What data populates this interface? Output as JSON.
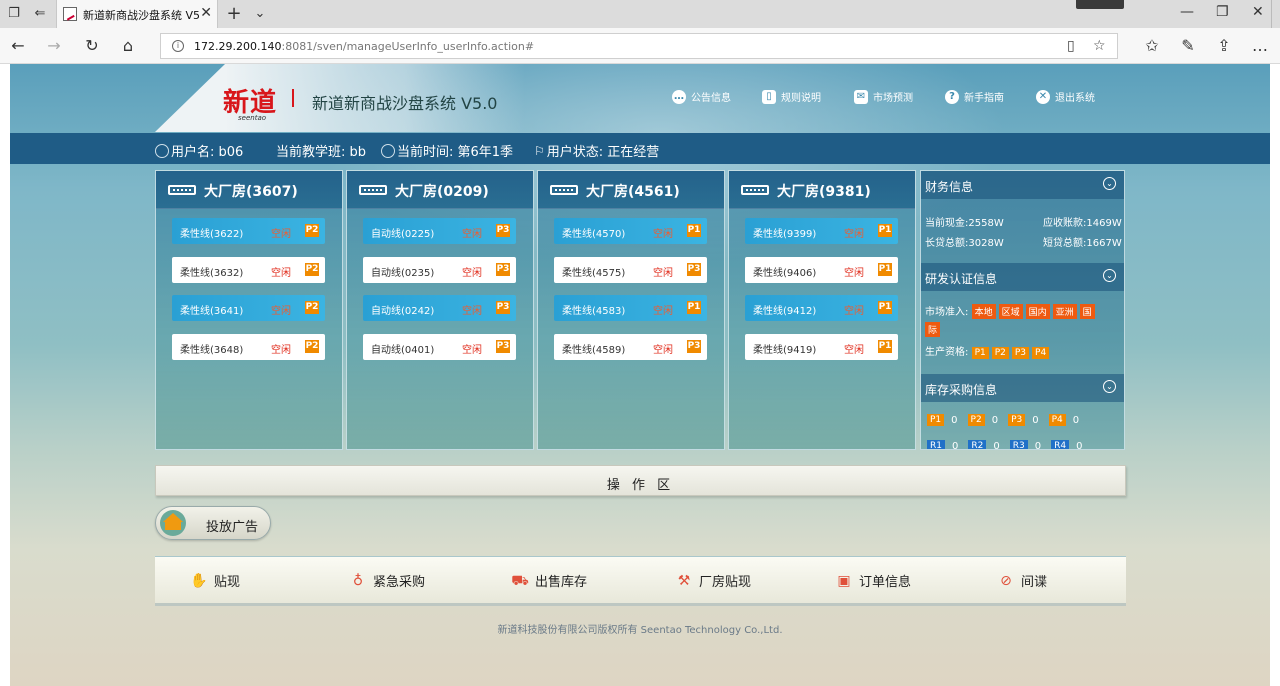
{
  "browser": {
    "tab_title": "新道新商战沙盘系统 V5",
    "url_host": "172.29.200.140",
    "url_rest": ":8081/sven/manageUserInfo_userInfo.action#"
  },
  "header": {
    "logo_text": "新道",
    "logo_sub": "seentao",
    "system_title": "新道新商战沙盘系统 V5.0",
    "nav": [
      {
        "label": "公告信息",
        "icon": "chat-icon"
      },
      {
        "label": "规则说明",
        "icon": "document-icon"
      },
      {
        "label": "市场预测",
        "icon": "mail-icon"
      },
      {
        "label": "新手指南",
        "icon": "help-icon"
      },
      {
        "label": "退出系统",
        "icon": "close-circle-icon"
      }
    ]
  },
  "userbar": {
    "username": "用户名: b06",
    "class": "当前教学班: bb",
    "time": "当前时间: 第6年1季",
    "status": "用户状态:  正在经营"
  },
  "factories": [
    {
      "name": "大厂房(3607)",
      "lines": [
        {
          "name": "柔性线(3622)",
          "status": "空闲",
          "product": "P2",
          "style": "blue"
        },
        {
          "name": "柔性线(3632)",
          "status": "空闲",
          "product": "P2",
          "style": "white"
        },
        {
          "name": "柔性线(3641)",
          "status": "空闲",
          "product": "P2",
          "style": "blue"
        },
        {
          "name": "柔性线(3648)",
          "status": "空闲",
          "product": "P2",
          "style": "white"
        }
      ]
    },
    {
      "name": "大厂房(0209)",
      "lines": [
        {
          "name": "自动线(0225)",
          "status": "空闲",
          "product": "P3",
          "style": "blue"
        },
        {
          "name": "自动线(0235)",
          "status": "空闲",
          "product": "P3",
          "style": "white"
        },
        {
          "name": "自动线(0242)",
          "status": "空闲",
          "product": "P3",
          "style": "blue"
        },
        {
          "name": "自动线(0401)",
          "status": "空闲",
          "product": "P3",
          "style": "white"
        }
      ]
    },
    {
      "name": "大厂房(4561)",
      "lines": [
        {
          "name": "柔性线(4570)",
          "status": "空闲",
          "product": "P1",
          "style": "blue"
        },
        {
          "name": "柔性线(4575)",
          "status": "空闲",
          "product": "P3",
          "style": "white"
        },
        {
          "name": "柔性线(4583)",
          "status": "空闲",
          "product": "P1",
          "style": "blue"
        },
        {
          "name": "柔性线(4589)",
          "status": "空闲",
          "product": "P3",
          "style": "white"
        }
      ]
    },
    {
      "name": "大厂房(9381)",
      "lines": [
        {
          "name": "柔性线(9399)",
          "status": "空闲",
          "product": "P1",
          "style": "blue"
        },
        {
          "name": "柔性线(9406)",
          "status": "空闲",
          "product": "P1",
          "style": "white"
        },
        {
          "name": "柔性线(9412)",
          "status": "空闲",
          "product": "P1",
          "style": "blue"
        },
        {
          "name": "柔性线(9419)",
          "status": "空闲",
          "product": "P1",
          "style": "white"
        }
      ]
    }
  ],
  "finance": {
    "title": "财务信息",
    "cash": "当前现金:2558W",
    "receivable": "应收账款:1469W",
    "long_loan": "长贷总额:3028W",
    "short_loan": "短贷总额:1667W"
  },
  "rnd": {
    "title": "研发认证信息",
    "market_label": "市场准入:",
    "markets": [
      "本地",
      "区域",
      "国内",
      "亚洲",
      "国",
      "际"
    ],
    "production_label": "生产资格:",
    "products": [
      "P1",
      "P2",
      "P3",
      "P4"
    ]
  },
  "inventory": {
    "title": "库存采购信息",
    "products": [
      {
        "k": "P1",
        "v": "0"
      },
      {
        "k": "P2",
        "v": "0"
      },
      {
        "k": "P3",
        "v": "0"
      },
      {
        "k": "P4",
        "v": "0"
      }
    ],
    "materials": [
      {
        "k": "R1",
        "v": "0"
      },
      {
        "k": "R2",
        "v": "0"
      },
      {
        "k": "R3",
        "v": "0"
      },
      {
        "k": "R4",
        "v": "0"
      }
    ]
  },
  "operation": {
    "title": "操 作 区",
    "ad_button": "投放广告"
  },
  "actions": [
    {
      "label": "贴现",
      "icon": "hand-coin-icon"
    },
    {
      "label": "紧急采购",
      "icon": "urgent-icon"
    },
    {
      "label": "出售库存",
      "icon": "truck-icon"
    },
    {
      "label": "厂房贴现",
      "icon": "forklift-icon"
    },
    {
      "label": "订单信息",
      "icon": "order-icon"
    },
    {
      "label": "间谍",
      "icon": "compass-icon"
    }
  ],
  "footer": "新道科技股份有限公司版权所有 Seentao Technology Co.,Ltd."
}
